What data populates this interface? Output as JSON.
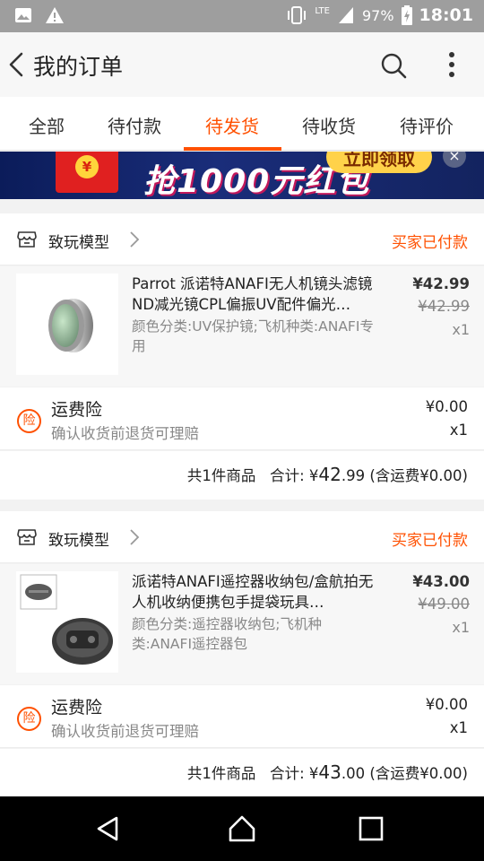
{
  "status_bar": {
    "network": "LTE",
    "battery": "97%",
    "time": "18:01",
    "icons": [
      "image-icon",
      "warning-icon",
      "vibrate-icon",
      "signal-icon",
      "battery-icon"
    ]
  },
  "app_bar": {
    "title": "我的订单",
    "icons": [
      "back-icon",
      "search-icon",
      "more-icon"
    ]
  },
  "tabs": [
    {
      "label": "全部",
      "active": false
    },
    {
      "label": "待付款",
      "active": false
    },
    {
      "label": "待发货",
      "active": true
    },
    {
      "label": "待收货",
      "active": false
    },
    {
      "label": "待评价",
      "active": false
    }
  ],
  "banner": {
    "text": "抢1000元红包",
    "button": "立即领取",
    "coin": "¥",
    "close": "×"
  },
  "orders": [
    {
      "shop": "致玩模型",
      "status": "买家已付款",
      "item": {
        "title": "Parrot 派诺特ANAFI无人机镜头滤镜ND减光镜CPL偏振UV配件偏光…",
        "sku": "颜色分类:UV保护镜;飞机种类:ANAFI专用",
        "price": "¥42.99",
        "original_price": "¥42.99",
        "qty": "x1"
      },
      "insurance": {
        "badge": "险",
        "title": "运费险",
        "desc": "确认收货前退货可理赔",
        "price": "¥0.00",
        "qty": "x1"
      },
      "summary": {
        "count": "共1件商品",
        "total_label": "合计:",
        "currency": "¥",
        "amount_int": "42",
        "amount_dec": ".99",
        "shipping": "(含运费¥0.00)"
      }
    },
    {
      "shop": "致玩模型",
      "status": "买家已付款",
      "item": {
        "title": "派诺特ANAFI遥控器收纳包/盒航拍无人机收纳便携包手提袋玩具…",
        "sku": "颜色分类:遥控器收纳包;飞机种类:ANAFI遥控器包",
        "price": "¥43.00",
        "original_price": "¥49.00",
        "qty": "x1"
      },
      "insurance": {
        "badge": "险",
        "title": "运费险",
        "desc": "确认收货前退货可理赔",
        "price": "¥0.00",
        "qty": "x1"
      },
      "summary": {
        "count": "共1件商品",
        "total_label": "合计:",
        "currency": "¥",
        "amount_int": "43",
        "amount_dec": ".00",
        "shipping": "(含运费¥0.00)"
      }
    }
  ],
  "colors": {
    "accent": "#ff5000",
    "banner_bg": "#13235f",
    "status_bar": "#9e9e9e"
  }
}
